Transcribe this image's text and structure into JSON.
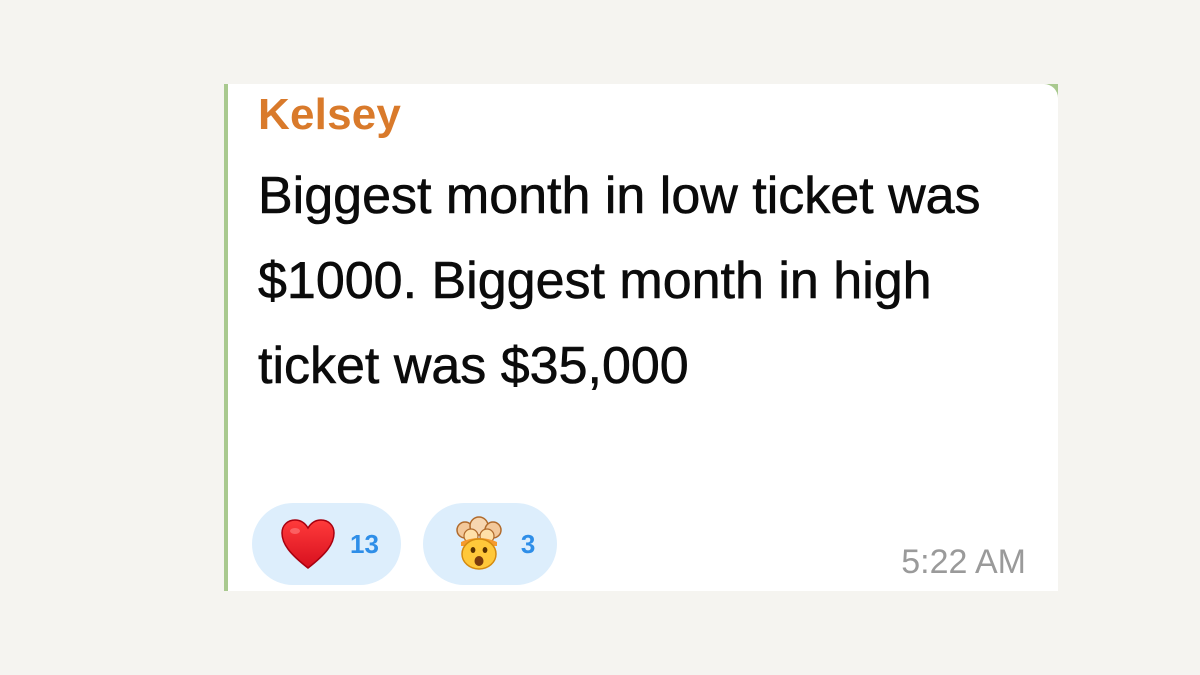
{
  "message": {
    "sender": "Kelsey",
    "text": "Biggest month in low ticket was $1000. Biggest month in high ticket was $35,000",
    "time": "5:22 AM",
    "reactions": [
      {
        "icon": "red-heart-icon",
        "count": "13"
      },
      {
        "icon": "exploding-head-icon",
        "count": "3"
      }
    ]
  },
  "colors": {
    "sender": "#d97a2b",
    "reaction_bg": "#ddeefc",
    "reaction_count": "#2e8ee8",
    "time": "#9a9a9a",
    "chat_background": "#a9c98f"
  }
}
